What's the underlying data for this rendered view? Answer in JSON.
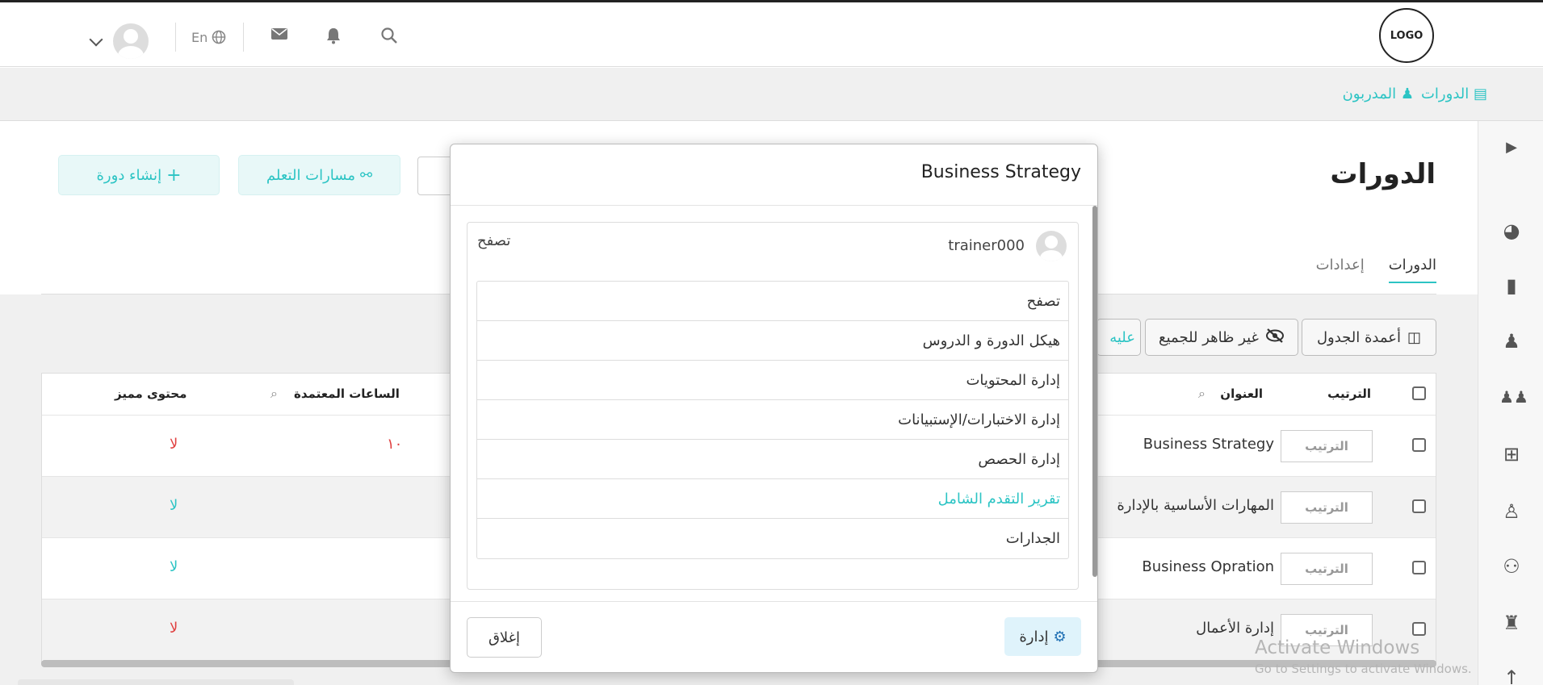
{
  "header": {
    "logo_text": "LOGO",
    "lang_label": "En",
    "icons": [
      "search-icon",
      "bell-icon",
      "mail-icon",
      "globe-icon",
      "avatar",
      "chevron-down-icon"
    ]
  },
  "subnav": {
    "courses": "الدورات",
    "trainers": "المدربون"
  },
  "page": {
    "title": "الدورات",
    "create_course": "إنشاء دورة",
    "learning_paths": "مسارات التعلم",
    "tabs": [
      "الدورات",
      "إعدادات"
    ]
  },
  "toolbar": {
    "table_columns": "أعمدة الجدول",
    "hidden_for_all": "غير ظاهر للجميع",
    "partial": "عليه"
  },
  "table": {
    "headers": {
      "order": "الترتيب",
      "title": "العنوان",
      "credit_hours": "الساعات المعتمدة",
      "featured": "محتوى مميز"
    },
    "order_placeholder": "الترتيب",
    "rows": [
      {
        "title": "Business Strategy",
        "credit_hours": "١٠",
        "featured": "لا"
      },
      {
        "title": "المهارات الأساسية بالإدارة",
        "credit_hours": "",
        "featured": "لا"
      },
      {
        "title": "Business Opration",
        "credit_hours": "",
        "featured": "لا"
      },
      {
        "title": "إدارة الأعمال",
        "credit_hours": "",
        "featured": "لا"
      }
    ]
  },
  "modal": {
    "title": "Business Strategy",
    "trainer": "trainer000",
    "browse_label": "تصفح",
    "menu": [
      "تصفح",
      "هيكل الدورة و الدروس",
      "إدارة المحتويات",
      "إدارة الاختبارات/الإستبيانات",
      "إدارة الحصص",
      "تقرير التقدم الشامل",
      "الجدارات"
    ],
    "close": "إغلاق",
    "manage": "إدارة"
  },
  "watermark": {
    "line1": "Activate Windows",
    "line2": "Go to Settings to activate Windows."
  },
  "colors": {
    "accent": "#2cc4c4",
    "negative": "#e04040"
  }
}
